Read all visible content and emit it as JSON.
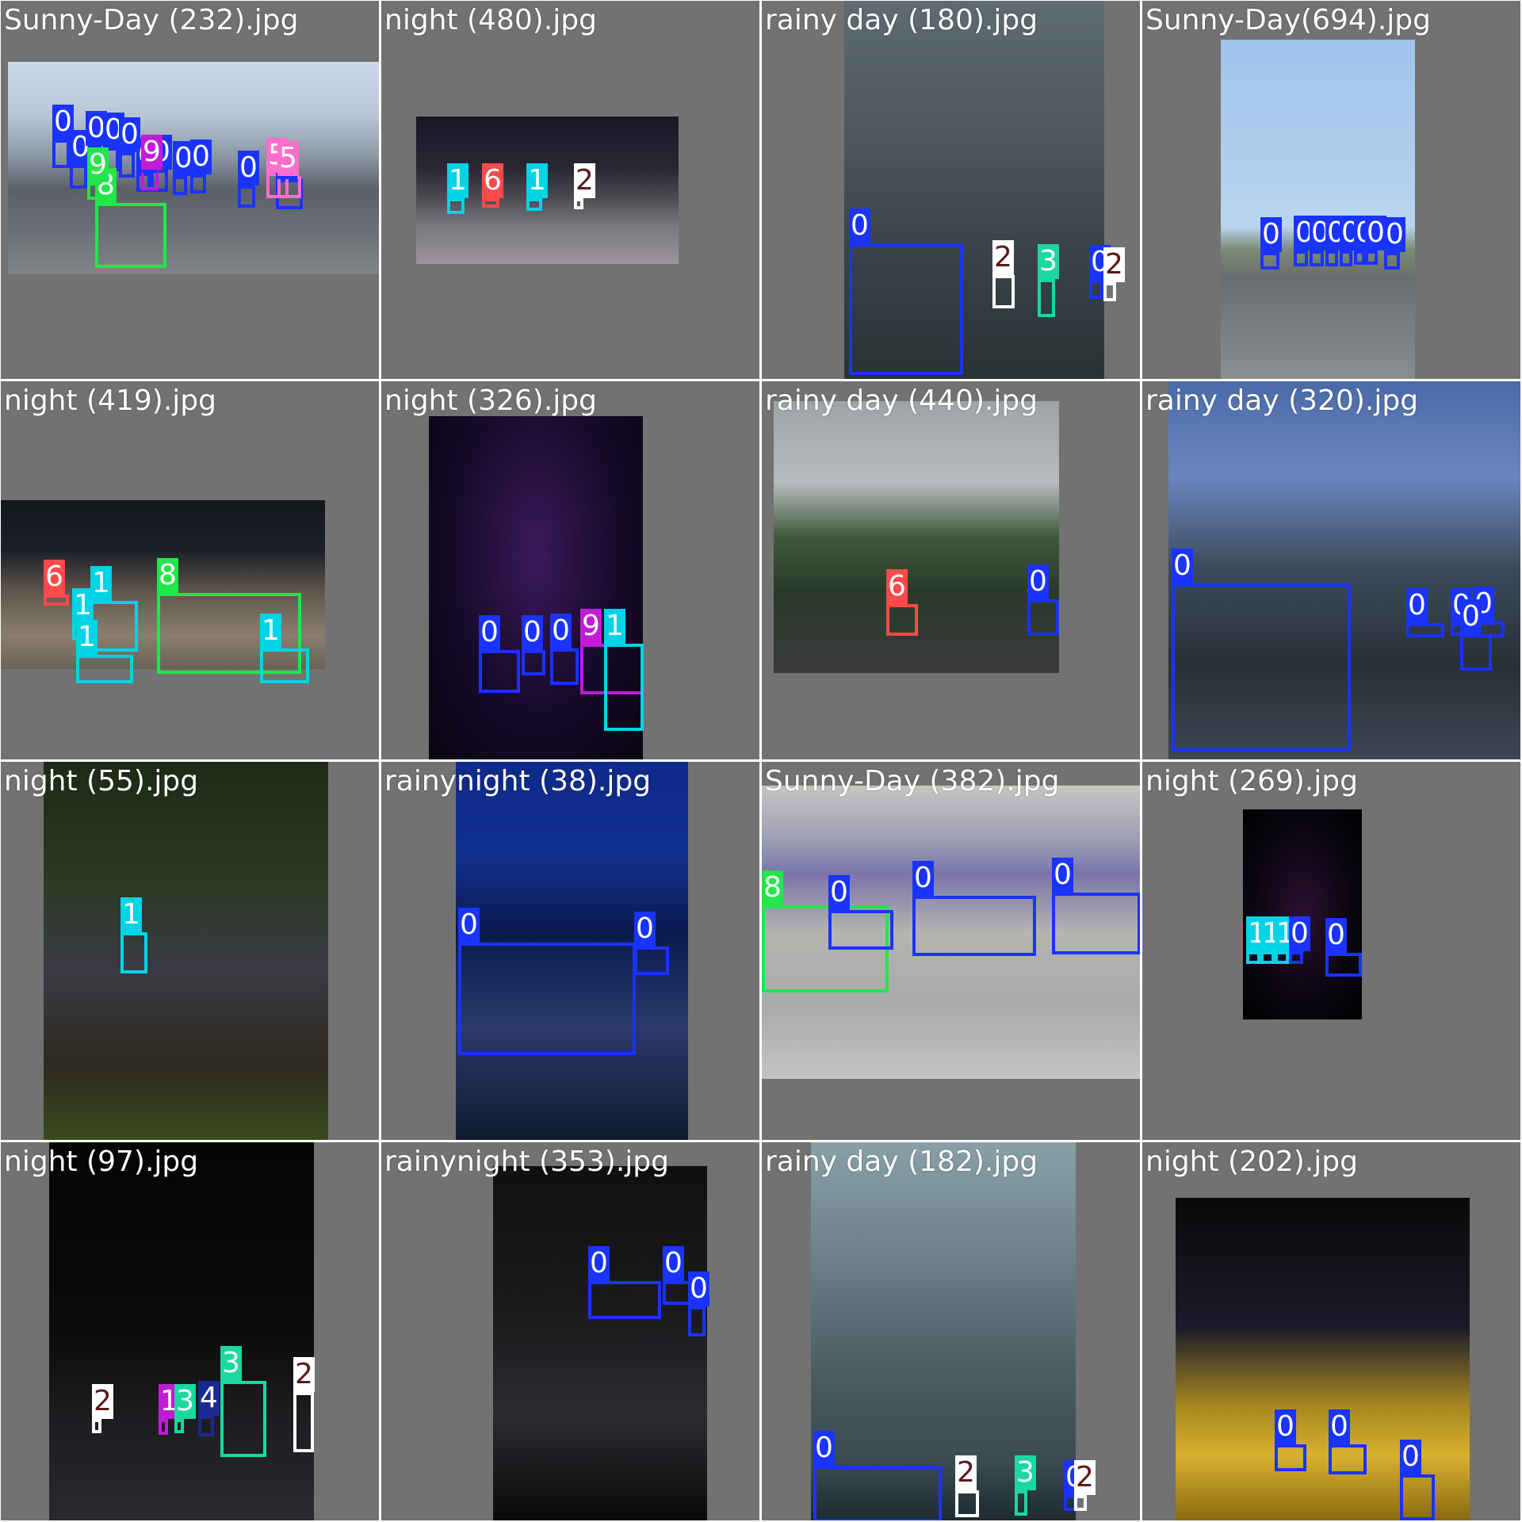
{
  "class_colors": {
    "0": "#1a33ff",
    "1": "#00d4e6",
    "2": "#ffffff",
    "3": "#1ad8a0",
    "4": "#1a2a90",
    "5": "#ff6ecb",
    "6": "#ff4a4a",
    "8": "#22e64a",
    "9": "#c31ad8"
  },
  "class_text_colors": {
    "2": "#5a1a1a"
  },
  "tiles": [
    {
      "title": "Sunny-Day (232).jpg",
      "scene": "sunny-city",
      "detections": [
        {
          "cls": "0",
          "label": "0"
        },
        {
          "cls": "0",
          "label": "0"
        },
        {
          "cls": "0",
          "label": "0"
        },
        {
          "cls": "0",
          "label": "0"
        },
        {
          "cls": "0",
          "label": "0"
        },
        {
          "cls": "0",
          "label": "0"
        },
        {
          "cls": "0",
          "label": "0"
        },
        {
          "cls": "0",
          "label": "0"
        },
        {
          "cls": "0",
          "label": "0"
        },
        {
          "cls": "0",
          "label": "0"
        },
        {
          "cls": "0",
          "label": "0"
        },
        {
          "cls": "9",
          "label": "9"
        },
        {
          "cls": "5",
          "label": "5"
        },
        {
          "cls": "5",
          "label": "5"
        },
        {
          "cls": "8",
          "label": "8"
        },
        {
          "cls": "8",
          "label": "9"
        }
      ]
    },
    {
      "title": "night (480).jpg",
      "scene": "night-plaza",
      "detections": [
        {
          "cls": "1",
          "label": "1"
        },
        {
          "cls": "6",
          "label": "6"
        },
        {
          "cls": "1",
          "label": "1"
        },
        {
          "cls": "2",
          "label": "2"
        }
      ]
    },
    {
      "title": "rainy day (180).jpg",
      "scene": "rainy-street",
      "detections": [
        {
          "cls": "0",
          "label": "0"
        },
        {
          "cls": "2",
          "label": "2"
        },
        {
          "cls": "3",
          "label": "3"
        },
        {
          "cls": "0",
          "label": "0"
        },
        {
          "cls": "2",
          "label": "2"
        }
      ]
    },
    {
      "title": "Sunny-Day(694).jpg",
      "scene": "sunny-highway",
      "detections": [
        {
          "cls": "0",
          "label": "0"
        },
        {
          "cls": "0",
          "label": "0"
        },
        {
          "cls": "0",
          "label": "0"
        },
        {
          "cls": "0",
          "label": "0"
        },
        {
          "cls": "0",
          "label": "0"
        },
        {
          "cls": "0",
          "label": "0"
        },
        {
          "cls": "0",
          "label": "0"
        },
        {
          "cls": "0",
          "label": "0"
        }
      ]
    },
    {
      "title": "night (419).jpg",
      "scene": "night-traffic",
      "detections": [
        {
          "cls": "6",
          "label": "6"
        },
        {
          "cls": "1",
          "label": "1"
        },
        {
          "cls": "1",
          "label": "1"
        },
        {
          "cls": "1",
          "label": "1"
        },
        {
          "cls": "8",
          "label": "8"
        },
        {
          "cls": "1",
          "label": "1"
        }
      ]
    },
    {
      "title": "night (326).jpg",
      "scene": "night-lights",
      "detections": [
        {
          "cls": "0",
          "label": "0"
        },
        {
          "cls": "0",
          "label": "0"
        },
        {
          "cls": "0",
          "label": "0"
        },
        {
          "cls": "9",
          "label": "9"
        },
        {
          "cls": "1",
          "label": "1"
        }
      ]
    },
    {
      "title": "rainy day (440).jpg",
      "scene": "rainy-hills",
      "detections": [
        {
          "cls": "6",
          "label": "6"
        },
        {
          "cls": "0",
          "label": "0"
        }
      ]
    },
    {
      "title": "rainy day (320).jpg",
      "scene": "rainy-village",
      "detections": [
        {
          "cls": "0",
          "label": "0"
        },
        {
          "cls": "0",
          "label": "0"
        },
        {
          "cls": "0",
          "label": "0"
        },
        {
          "cls": "0",
          "label": "0"
        },
        {
          "cls": "0",
          "label": "0"
        }
      ]
    },
    {
      "title": "night (55).jpg",
      "scene": "night-tree",
      "detections": [
        {
          "cls": "1",
          "label": "1"
        }
      ]
    },
    {
      "title": "rainynight (38).jpg",
      "scene": "rainy-night-car",
      "detections": [
        {
          "cls": "0",
          "label": "0"
        },
        {
          "cls": "0",
          "label": "0"
        }
      ]
    },
    {
      "title": "Sunny-Day (382).jpg",
      "scene": "sunny-billboard",
      "detections": [
        {
          "cls": "8",
          "label": "8"
        },
        {
          "cls": "0",
          "label": "0"
        },
        {
          "cls": "0",
          "label": "0"
        },
        {
          "cls": "0",
          "label": "0"
        }
      ]
    },
    {
      "title": "night (269).jpg",
      "scene": "night-festival",
      "detections": [
        {
          "cls": "1",
          "label": "1"
        },
        {
          "cls": "1",
          "label": "1"
        },
        {
          "cls": "1",
          "label": "1"
        },
        {
          "cls": "0",
          "label": "0"
        },
        {
          "cls": "0",
          "label": "0"
        }
      ]
    },
    {
      "title": "night (97).jpg",
      "scene": "night-street",
      "detections": [
        {
          "cls": "2",
          "label": "2"
        },
        {
          "cls": "9",
          "label": "1"
        },
        {
          "cls": "3",
          "label": "3"
        },
        {
          "cls": "4",
          "label": "4"
        },
        {
          "cls": "3",
          "label": "3"
        },
        {
          "cls": "2",
          "label": "2"
        }
      ]
    },
    {
      "title": "rainynight (353).jpg",
      "scene": "rainy-night-road",
      "detections": [
        {
          "cls": "0",
          "label": "0"
        },
        {
          "cls": "0",
          "label": "0"
        },
        {
          "cls": "0",
          "label": "0"
        }
      ]
    },
    {
      "title": "rainy day (182).jpg",
      "scene": "rainy-tower",
      "detections": [
        {
          "cls": "0",
          "label": "0"
        },
        {
          "cls": "2",
          "label": "2"
        },
        {
          "cls": "3",
          "label": "3"
        },
        {
          "cls": "0",
          "label": "0"
        },
        {
          "cls": "2",
          "label": "2"
        }
      ]
    },
    {
      "title": "night (202).jpg",
      "scene": "night-bridge",
      "detections": [
        {
          "cls": "0",
          "label": "0"
        },
        {
          "cls": "0",
          "label": "0"
        },
        {
          "cls": "0",
          "label": "0"
        }
      ]
    }
  ]
}
